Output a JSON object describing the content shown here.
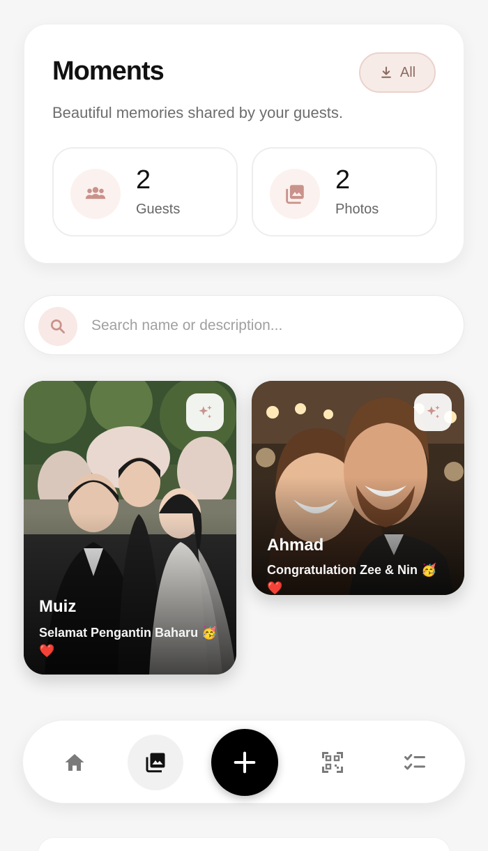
{
  "header": {
    "title": "Moments",
    "download_label": "All",
    "subtitle": "Beautiful memories shared by your guests."
  },
  "stats": [
    {
      "value": "2",
      "label": "Guests",
      "icon": "group-icon"
    },
    {
      "value": "2",
      "label": "Photos",
      "icon": "photo-library-icon"
    }
  ],
  "search": {
    "placeholder": "Search name or description...",
    "value": ""
  },
  "moments": [
    {
      "name": "Muiz",
      "description": "Selamat Pengantin Baharu 🥳❤️"
    },
    {
      "name": "Ahmad",
      "description": "Congratulation Zee & Nin 🥳❤️"
    }
  ],
  "nav": {
    "items": [
      "home-icon",
      "gallery-icon",
      "add-icon",
      "qr-code-icon",
      "checklist-icon"
    ],
    "active": "gallery-icon"
  },
  "colors": {
    "accent": "#f7ebe7",
    "accent_text": "#8b6a62",
    "icon_tint": "#c9928a",
    "background": "#f6f6f6",
    "primary": "#000000"
  }
}
